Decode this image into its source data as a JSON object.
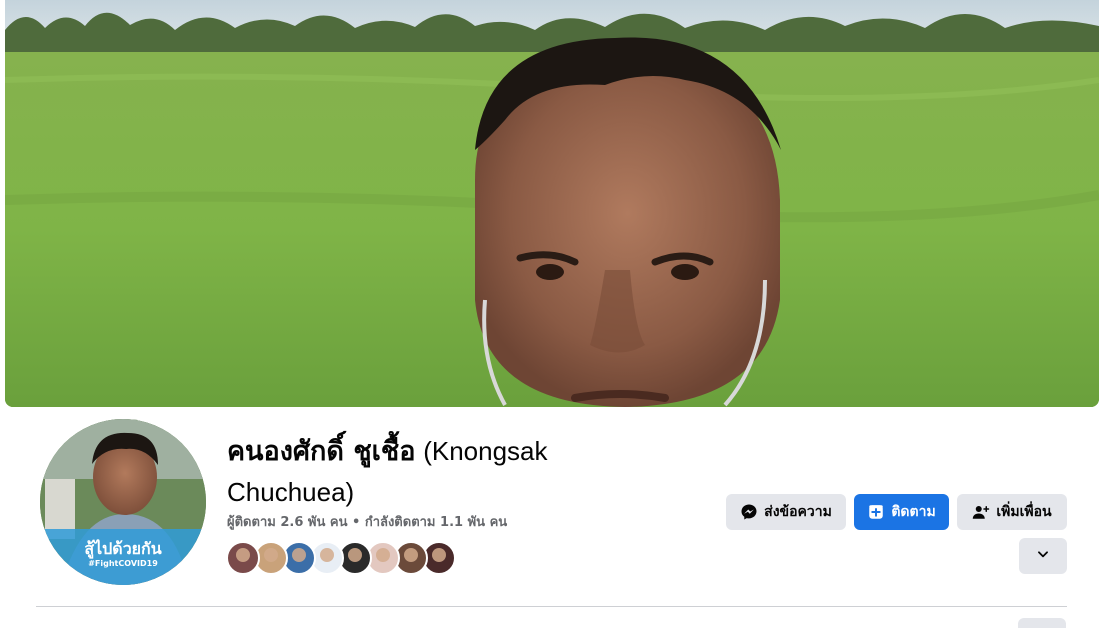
{
  "profile": {
    "name_thai": "คนองศักดิ์ ชูเชื้อ",
    "name_alt": "(Knongsak Chuchuea)",
    "stats": "ผู้ติดตาม 2.6 พัน คน • กำลังติดตาม 1.1 พัน คน",
    "avatar_frame_text": "สู้ไปด้วยกัน",
    "avatar_frame_hashtag": "#FightCOVID19"
  },
  "actions": {
    "message_label": "ส่งข้อความ",
    "follow_label": "ติดตาม",
    "add_friend_label": "เพิ่มเพื่อน"
  },
  "friends_preview": [
    {
      "color": "#7a4a4a"
    },
    {
      "color": "#c9a27a"
    },
    {
      "color": "#3b6ea8"
    },
    {
      "color": "#e8eef5"
    },
    {
      "color": "#2a2a2a"
    },
    {
      "color": "#e3c8c0"
    },
    {
      "color": "#6b4a3a"
    },
    {
      "color": "#4a2a2a"
    }
  ],
  "colors": {
    "accent": "#1b74e4",
    "button_gray": "#e4e6eb",
    "secondary_text": "#65676b"
  },
  "icons": {
    "message": "messenger-icon",
    "follow": "follow-plus-icon",
    "add_friend": "add-friend-icon",
    "more": "chevron-down-icon"
  }
}
